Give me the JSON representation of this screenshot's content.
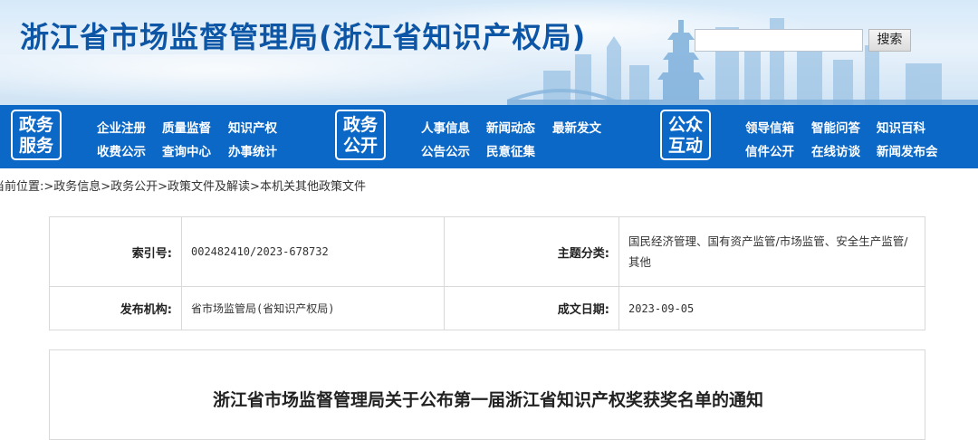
{
  "header": {
    "site_title": "浙江省市场监督管理局(浙江省知识产权局)",
    "search": {
      "placeholder": "",
      "value": "",
      "button_label": "搜索"
    }
  },
  "nav": {
    "groups": [
      {
        "badge": [
          "政务",
          "服务"
        ],
        "links": [
          "企业注册",
          "质量监督",
          "知识产权",
          "收费公示",
          "查询中心",
          "办事统计"
        ]
      },
      {
        "badge": [
          "政务",
          "公开"
        ],
        "links": [
          "人事信息",
          "新闻动态",
          "最新发文",
          "公告公示",
          "民意征集"
        ]
      },
      {
        "badge": [
          "公众",
          "互动"
        ],
        "links": [
          "领导信箱",
          "智能问答",
          "知识百科",
          "信件公开",
          "在线访谈",
          "新闻发布会"
        ]
      }
    ]
  },
  "breadcrumb": "当前位置:>政务信息>政务公开>政策文件及解读>本机关其他政策文件",
  "meta": {
    "index_label": "索引号:",
    "index_value": "002482410/2023-678732",
    "topic_label": "主题分类:",
    "topic_value": "国民经济管理、国有资产监管/市场监管、安全生产监管/其他",
    "org_label": "发布机构:",
    "org_value": "省市场监管局(省知识产权局)",
    "date_label": "成文日期:",
    "date_value": "2023-09-05"
  },
  "content": {
    "title": "浙江省市场监督管理局关于公布第一届浙江省知识产权奖获奖名单的通知"
  },
  "colors": {
    "nav_background": "#0c68c7",
    "title_blue": "#0d56a6"
  }
}
